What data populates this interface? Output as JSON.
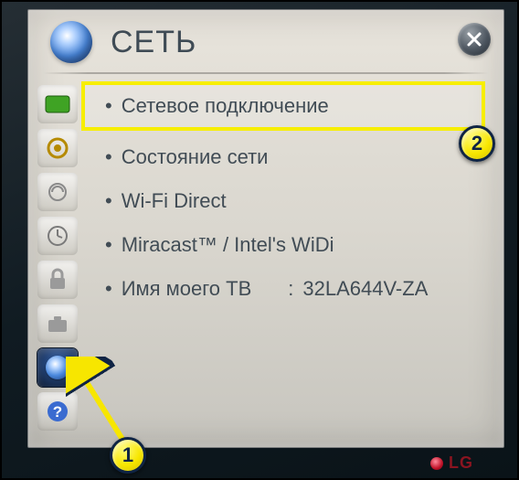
{
  "header": {
    "title": "СЕТЬ"
  },
  "menu": {
    "items": [
      {
        "label": "Сетевое подключение",
        "highlighted": true
      },
      {
        "label": "Состояние сети"
      },
      {
        "label": "Wi-Fi Direct"
      },
      {
        "label": "Miracast™ / Intel's WiDi"
      }
    ],
    "tvName": {
      "label": "Имя моего ТВ",
      "value": "32LA644V-ZA"
    }
  },
  "sidebar": {
    "items": [
      {
        "name": "picture",
        "color": "#3fa324"
      },
      {
        "name": "sound",
        "color": "#b58a00"
      },
      {
        "name": "channel",
        "color": "#8a8a8a"
      },
      {
        "name": "time",
        "color": "#8a8a8a"
      },
      {
        "name": "lock",
        "color": "#8a8a8a"
      },
      {
        "name": "option",
        "color": "#8a8a8a"
      },
      {
        "name": "network",
        "color": "#8a8a8a",
        "selected": true
      },
      {
        "name": "support",
        "color": "#3a6bd0"
      }
    ]
  },
  "annotations": {
    "one": "1",
    "two": "2"
  },
  "brand": "LG"
}
